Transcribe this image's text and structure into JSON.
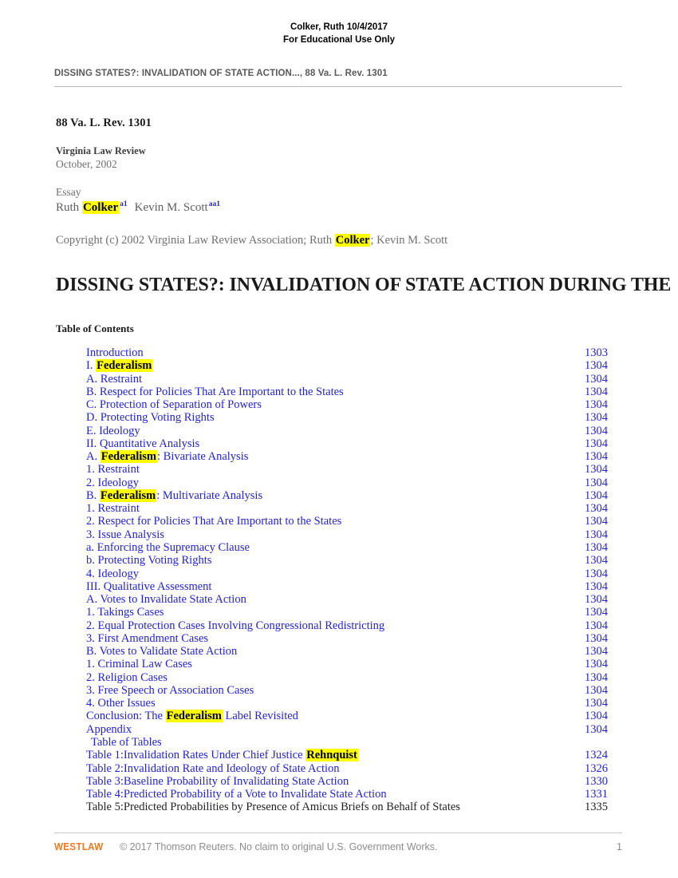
{
  "watermark": {
    "line1": "Colker, Ruth 10/4/2017",
    "line2": "For Educational Use Only"
  },
  "running_header": "DISSING STATES?: INVALIDATION OF STATE ACTION..., 88 Va. L. Rev. 1301",
  "metadata": {
    "citation": "88 Va. L. Rev. 1301",
    "journal": "Virginia Law Review",
    "date": "October, 2002",
    "doc_type": "Essay",
    "author_prefix": "Ruth ",
    "author_highlight": "Colker",
    "author_footnote": "a1",
    "author2": "Kevin M. Scott",
    "author2_footnote": "aa1",
    "copyright_before": "Copyright (c) 2002 Virginia Law Review Association; Ruth ",
    "copyright_highlight": "Colker",
    "copyright_after": "; Kevin M. Scott"
  },
  "title": "DISSING STATES?: INVALIDATION OF STATE ACTION DURING THE",
  "toc_heading": "Table of Contents",
  "toc": [
    {
      "label": "Introduction",
      "page": "1303",
      "link": true
    },
    {
      "label_pre": "I. ",
      "highlight": "Federalism",
      "label_post": "",
      "page": "1304",
      "link": true
    },
    {
      "label": "A. Restraint",
      "page": "1304",
      "link": true
    },
    {
      "label": "B. Respect for Policies That Are Important to the States",
      "page": "1304",
      "link": true
    },
    {
      "label": "C. Protection of Separation of Powers",
      "page": "1304",
      "link": true
    },
    {
      "label": "D. Protecting Voting Rights",
      "page": "1304",
      "link": true
    },
    {
      "label": "E. Ideology",
      "page": "1304",
      "link": true
    },
    {
      "label": "II. Quantitative Analysis",
      "page": "1304",
      "link": true
    },
    {
      "label_pre": "A. ",
      "highlight": "Federalism",
      "label_post": ": Bivariate Analysis",
      "page": "1304",
      "link": true
    },
    {
      "label": "1. Restraint",
      "page": "1304",
      "link": true
    },
    {
      "label": "2. Ideology",
      "page": "1304",
      "link": true
    },
    {
      "label_pre": "B. ",
      "highlight": "Federalism",
      "label_post": ": Multivariate Analysis",
      "page": "1304",
      "link": true
    },
    {
      "label": "1. Restraint",
      "page": "1304",
      "link": true
    },
    {
      "label": "2. Respect for Policies That Are Important to the States",
      "page": "1304",
      "link": true
    },
    {
      "label": "3. Issue Analysis",
      "page": "1304",
      "link": true
    },
    {
      "label": "a. Enforcing the Supremacy Clause",
      "page": "1304",
      "link": true
    },
    {
      "label": "b. Protecting Voting Rights",
      "page": "1304",
      "link": true
    },
    {
      "label": "4. Ideology",
      "page": "1304",
      "link": true
    },
    {
      "label": "III. Qualitative Assessment",
      "page": "1304",
      "link": true
    },
    {
      "label": "A. Votes to Invalidate State Action",
      "page": "1304",
      "link": true
    },
    {
      "label": "1. Takings Cases",
      "page": "1304",
      "link": true
    },
    {
      "label": "2. Equal Protection Cases Involving Congressional Redistricting",
      "page": "1304",
      "link": true
    },
    {
      "label": "3. First Amendment Cases",
      "page": "1304",
      "link": true
    },
    {
      "label": "B. Votes to Validate State Action",
      "page": "1304",
      "link": true
    },
    {
      "label": "1. Criminal Law Cases",
      "page": "1304",
      "link": true
    },
    {
      "label": "2. Religion Cases",
      "page": "1304",
      "link": true
    },
    {
      "label": "3. Free Speech or Association Cases",
      "page": "1304",
      "link": true
    },
    {
      "label": "4. Other Issues",
      "page": "1304",
      "link": true
    },
    {
      "label_pre": "Conclusion: The ",
      "highlight": "Federalism",
      "label_post": " Label Revisited",
      "page": "1304",
      "link": true
    },
    {
      "label": "Appendix",
      "page": "1304",
      "link": true
    },
    {
      "label": "Table of Tables",
      "page": "",
      "link": true,
      "indent": true
    },
    {
      "label_pre": "Table 1:Invalidation Rates Under Chief Justice ",
      "highlight": "Rehnquist",
      "label_post": "",
      "page": "1324",
      "link": true
    },
    {
      "label": "Table 2:Invalidation Rate and Ideology of State Action",
      "page": "1326",
      "link": true
    },
    {
      "label": "Table 3:Baseline Probability of Invalidating State Action",
      "page": "1330",
      "link": true
    },
    {
      "label": "Table 4:Predicted Probability of a Vote to Invalidate State Action",
      "page": "1331",
      "link": true
    },
    {
      "label": "Table 5:Predicted Probabilities by Presence of Amicus Briefs on Behalf of States",
      "page": "1335",
      "link": false
    }
  ],
  "footer": {
    "logo": "WESTLAW",
    "copyright": "© 2017 Thomson Reuters. No claim to original U.S. Government Works.",
    "page_number": "1"
  },
  "colors": {
    "link": "#2222dd",
    "highlight": "#ffff00",
    "brand_orange": "#f07a23",
    "header_gray": "#595959"
  }
}
